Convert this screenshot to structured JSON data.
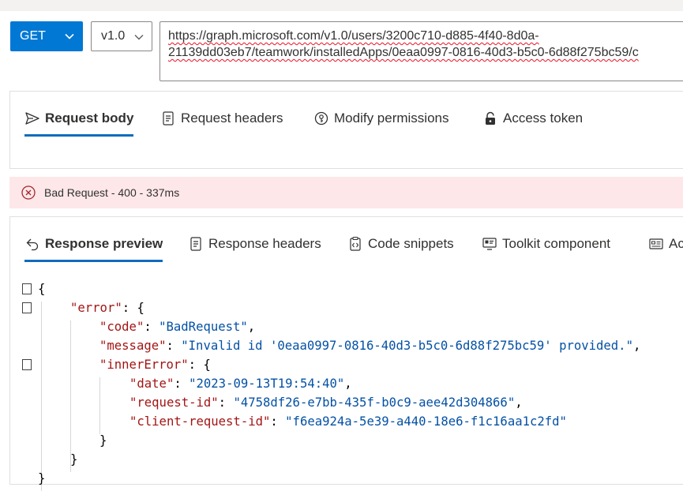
{
  "request": {
    "method": "GET",
    "version": "v1.0",
    "url_line1": "https://graph.microsoft.com/v1.0/users/3200c710-d885-4f40-8d0a-",
    "url_line2": "21139dd03eb7/teamwork/installedApps/0eaa0997-0816-40d3-b5c0-6d88f275bc59/c"
  },
  "request_tabs": [
    {
      "label": "Request body",
      "icon": "send-icon",
      "active": true
    },
    {
      "label": "Request headers",
      "icon": "document-icon",
      "active": false
    },
    {
      "label": "Modify permissions",
      "icon": "shield-key-icon",
      "active": false
    },
    {
      "label": "Access token",
      "icon": "lock-icon",
      "active": false
    }
  ],
  "status": {
    "text": "Bad Request - 400 - 337ms",
    "icon": "error-circle-icon",
    "color": "#fde7e9"
  },
  "response_tabs": [
    {
      "label": "Response preview",
      "icon": "undo-arrow-icon",
      "active": true
    },
    {
      "label": "Response headers",
      "icon": "document-icon",
      "active": false
    },
    {
      "label": "Code snippets",
      "icon": "clipboard-code-icon",
      "active": false
    },
    {
      "label": "Toolkit component",
      "icon": "toolkit-icon",
      "active": false
    },
    {
      "label": "Ac",
      "icon": "card-icon",
      "active": false
    }
  ],
  "response_json": {
    "error_key": "\"error\"",
    "code_key": "\"code\"",
    "code_val": "\"BadRequest\"",
    "message_key": "\"message\"",
    "message_val": "\"Invalid id '0eaa0997-0816-40d3-b5c0-6d88f275bc59' provided.\"",
    "inner_key": "\"innerError\"",
    "date_key": "\"date\"",
    "date_val": "\"2023-09-13T19:54:40\"",
    "reqid_key": "\"request-id\"",
    "reqid_val": "\"4758df26-e7bb-435f-b0c9-aee42d304866\"",
    "clientid_key": "\"client-request-id\"",
    "clientid_val": "\"f6ea924a-5e39-a440-18e6-f1c16aa1c2fd\""
  },
  "colors": {
    "accent": "#0078d4",
    "json_key": "#a31515",
    "json_string": "#0451a5"
  }
}
